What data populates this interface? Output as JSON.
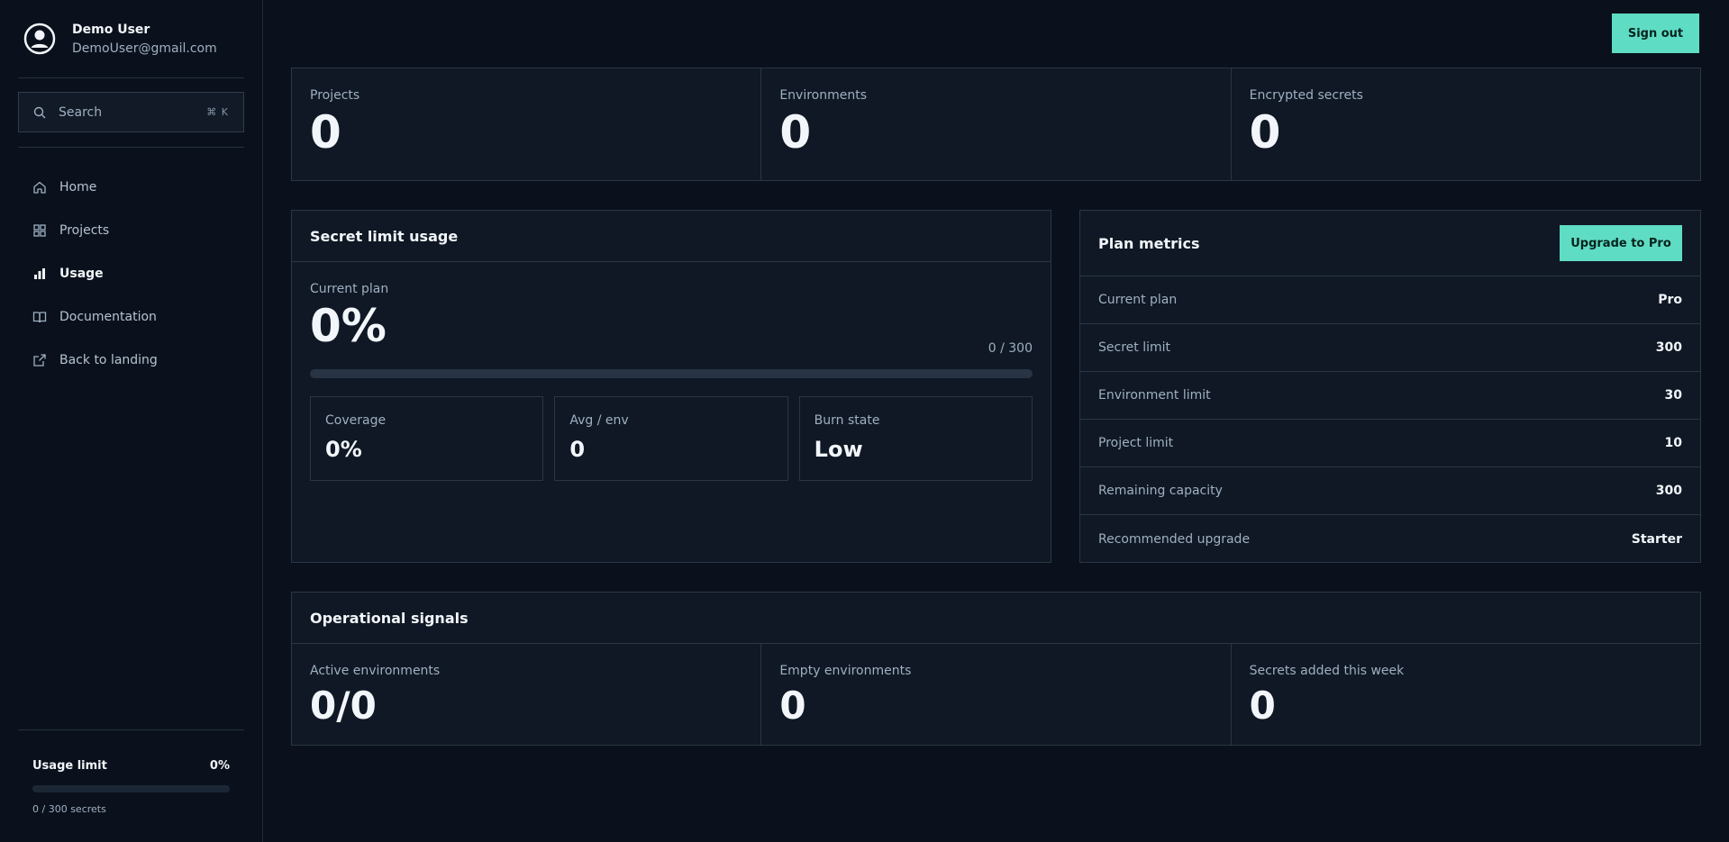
{
  "user": {
    "name": "Demo User",
    "email": "DemoUser@gmail.com"
  },
  "search": {
    "placeholder": "Search",
    "shortcut": "⌘ K"
  },
  "nav": [
    {
      "label": "Home",
      "icon": "home-icon"
    },
    {
      "label": "Projects",
      "icon": "grid-icon"
    },
    {
      "label": "Usage",
      "icon": "bar-chart-icon",
      "active": true
    },
    {
      "label": "Documentation",
      "icon": "book-icon"
    },
    {
      "label": "Back to landing",
      "icon": "external-link-icon"
    }
  ],
  "usage_limit": {
    "label": "Usage limit",
    "percent_text": "0%",
    "fill_fraction": 0,
    "summary": "0 / 300 secrets"
  },
  "header": {
    "signout_label": "Sign out"
  },
  "stats": [
    {
      "label": "Projects",
      "value": "0"
    },
    {
      "label": "Environments",
      "value": "0"
    },
    {
      "label": "Encrypted secrets",
      "value": "0"
    }
  ],
  "secret_usage": {
    "title": "Secret limit usage",
    "plan_label": "Current plan",
    "percent": "0%",
    "count": "0 / 300",
    "fill_fraction": 0,
    "cards": [
      {
        "label": "Coverage",
        "value": "0%"
      },
      {
        "label": "Avg / env",
        "value": "0"
      },
      {
        "label": "Burn state",
        "value": "Low"
      }
    ]
  },
  "plan_metrics": {
    "title": "Plan metrics",
    "upgrade_label": "Upgrade to Pro",
    "rows": [
      {
        "label": "Current plan",
        "value": "Pro"
      },
      {
        "label": "Secret limit",
        "value": "300"
      },
      {
        "label": "Environment limit",
        "value": "30"
      },
      {
        "label": "Project limit",
        "value": "10"
      },
      {
        "label": "Remaining capacity",
        "value": "300"
      },
      {
        "label": "Recommended upgrade",
        "value": "Starter"
      }
    ]
  },
  "signals": {
    "title": "Operational signals",
    "items": [
      {
        "label": "Active environments",
        "value": "0/0"
      },
      {
        "label": "Empty environments",
        "value": "0"
      },
      {
        "label": "Secrets added this week",
        "value": "0"
      }
    ]
  },
  "colors": {
    "accent": "#5fdcc4",
    "background": "#0a111c",
    "panel": "#0f1824"
  }
}
